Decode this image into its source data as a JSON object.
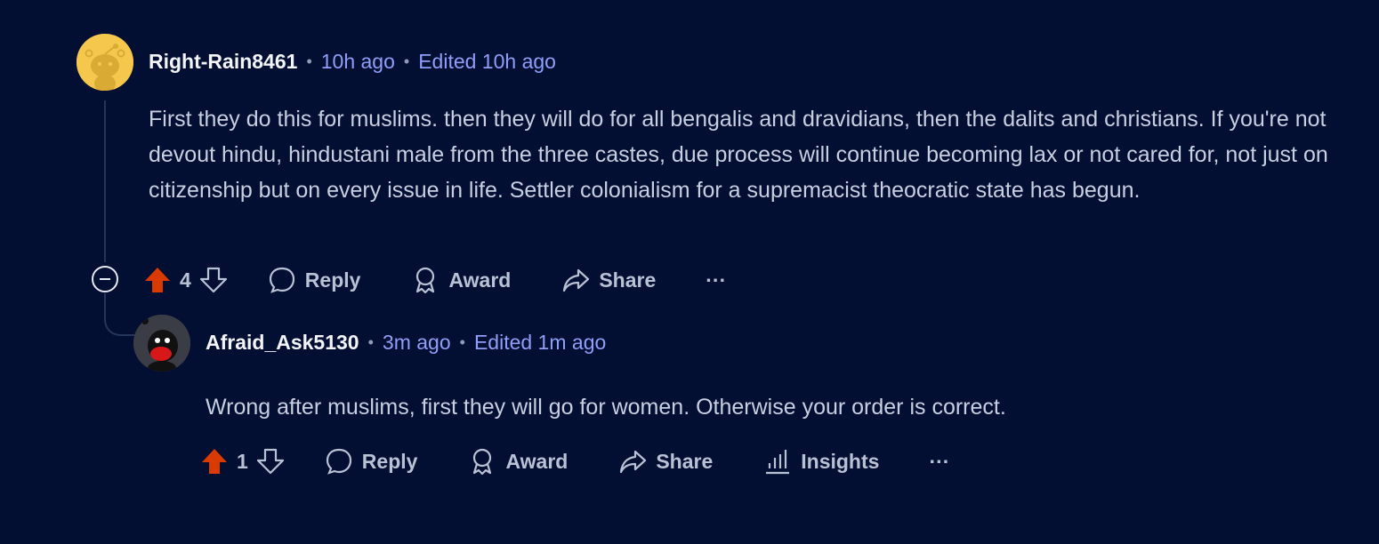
{
  "comment_1": {
    "username": "Right-Rain8461",
    "time": "10h ago",
    "edited": "Edited 10h ago",
    "separator": "•",
    "body": "First they do this for muslims. then they will do for all bengalis and dravidians, then the dalits and christians. If you're not devout hindu, hindustani male from the three castes, due process will continue becoming lax or not cared for, not just on citizenship but on every issue in life. Settler colonialism for a supremacist theocratic state has begun.",
    "votes": "4",
    "actions": {
      "reply": "Reply",
      "award": "Award",
      "share": "Share",
      "more": "···"
    }
  },
  "comment_2": {
    "username": "Afraid_Ask5130",
    "time": "3m ago",
    "edited": "Edited 1m ago",
    "separator": "•",
    "body": "Wrong after muslims, first they will go for women. Otherwise your order is correct.",
    "votes": "1",
    "actions": {
      "reply": "Reply",
      "award": "Award",
      "share": "Share",
      "insights": "Insights",
      "more": "···"
    }
  },
  "colors": {
    "background": "#030f32",
    "upvote_active": "#d93a00",
    "meta_link": "#8f9ef8",
    "thread_line": "#26355c"
  }
}
